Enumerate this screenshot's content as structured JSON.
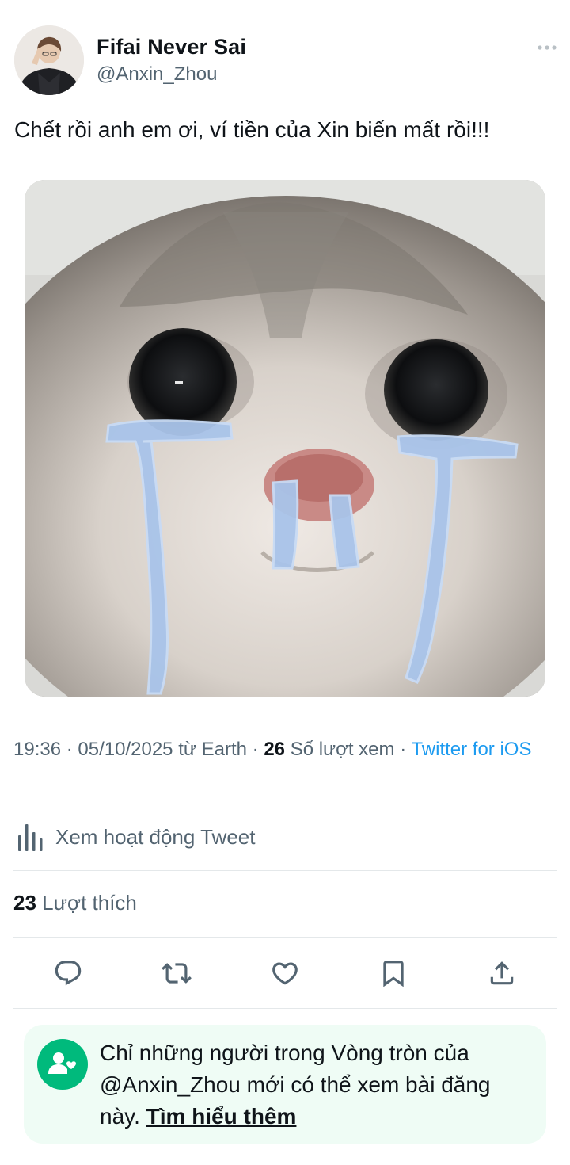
{
  "author": {
    "display_name": "Fifai Never Sai",
    "handle": "@Anxin_Zhou"
  },
  "tweet": {
    "text": "Chết rồi anh em ơi, ví tiền của Xin biến mất rồi!!!",
    "time": "19:36",
    "date": "05/10/2025",
    "location_prefix": "từ Earth",
    "views_count": "26",
    "views_label": "Số lượt xem",
    "client": "Twitter for iOS"
  },
  "activity": {
    "label": "Xem hoạt động Tweet",
    "icon": "analytics-bars-icon"
  },
  "likes": {
    "count": "23",
    "label": "Lượt thích"
  },
  "actions": [
    {
      "name": "reply",
      "icon": "reply-icon"
    },
    {
      "name": "retweet",
      "icon": "retweet-icon"
    },
    {
      "name": "like",
      "icon": "heart-icon"
    },
    {
      "name": "bookmark",
      "icon": "bookmark-icon"
    },
    {
      "name": "share",
      "icon": "share-icon"
    }
  ],
  "circle_notice": {
    "text": "Chỉ những người trong Vòng tròn của @Anxin_Zhou mới có thể xem bài đăng này.",
    "link": "Tìm hiểu thêm",
    "icon": "circle-people-icon"
  },
  "colors": {
    "text": "#0f1419",
    "secondary": "#536471",
    "link": "#1d9bf0",
    "circle_green": "#00ba7c",
    "circle_bg": "#effcf5"
  }
}
